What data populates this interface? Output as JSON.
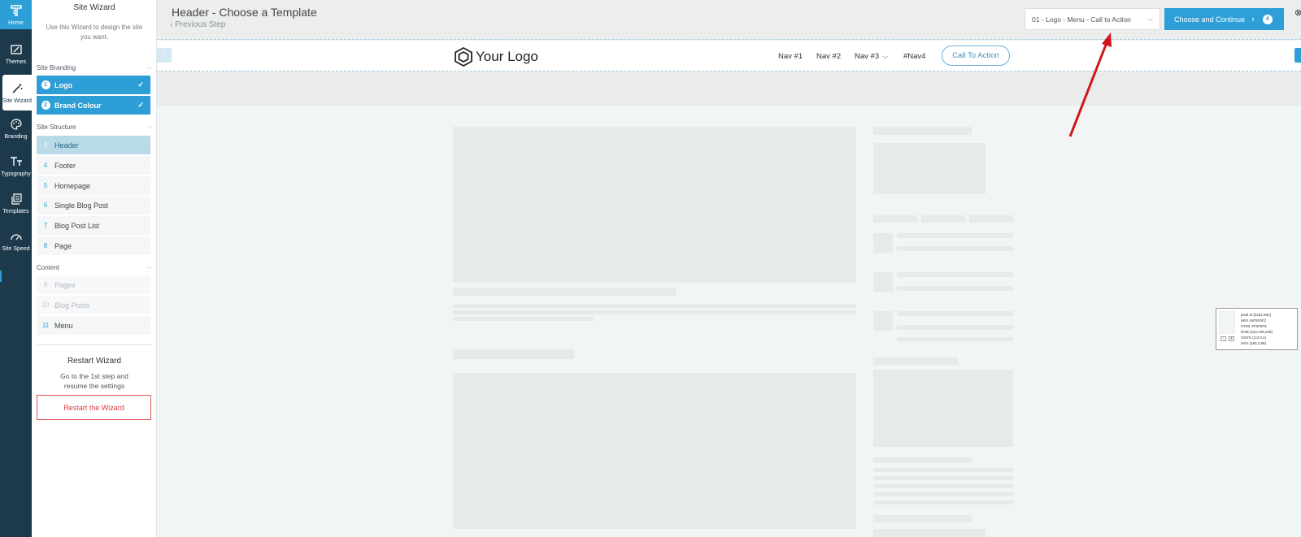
{
  "rail": {
    "items": [
      {
        "label": "Home",
        "icon": "home-icon"
      },
      {
        "label": "Themes",
        "icon": "themes-icon"
      },
      {
        "label": "Site Wizard",
        "icon": "wand-icon"
      },
      {
        "label": "Branding",
        "icon": "palette-icon"
      },
      {
        "label": "Typography",
        "icon": "typography-icon"
      },
      {
        "label": "Templates",
        "icon": "templates-icon"
      },
      {
        "label": "Site Speed",
        "icon": "speedometer-icon"
      }
    ]
  },
  "wizard": {
    "title": "Site Wizard",
    "description": "Use this Wizard to design the site you want.",
    "sections": [
      {
        "label": "Site Branding"
      },
      {
        "label": "Site Structure"
      },
      {
        "label": "Content"
      }
    ],
    "steps": [
      {
        "num": "1",
        "label": "Logo"
      },
      {
        "num": "2",
        "label": "Brand Colour"
      },
      {
        "num": "3",
        "label": "Header"
      },
      {
        "num": "4",
        "label": "Footer"
      },
      {
        "num": "5",
        "label": "Homepage"
      },
      {
        "num": "6",
        "label": "Single Blog Post"
      },
      {
        "num": "7",
        "label": "Blog Post List"
      },
      {
        "num": "8",
        "label": "Page"
      },
      {
        "num": "9",
        "label": "Pages"
      },
      {
        "num": "10",
        "label": "Blog Posts"
      },
      {
        "num": "11",
        "label": "Menu"
      }
    ],
    "check": "✓",
    "restart": {
      "title": "Restart Wizard",
      "description": "Go to the 1st step and resume the settings",
      "button": "Restart the Wizard"
    }
  },
  "topbar": {
    "title": "Header - Choose a Template",
    "previous": "Previous Step",
    "template_select": "01 - Logo - Menu - Call to Action",
    "choose_button": "Choose and Continue",
    "choose_badge": "4"
  },
  "preview": {
    "logo_text": "Your Logo",
    "nav": [
      "Nav #1",
      "Nav #2",
      "Nav #3",
      "#Nav4"
    ],
    "cta": "Call To Action"
  },
  "pixel_info": {
    "lines": [
      "pixel at [2221:681]",
      "HEX 0xF5F5F2",
      "HTML #F2F5F5",
      "RGB (242,245,245)",
      "CMYK (2,0,0,4)",
      "HSV (180,2,96)"
    ]
  },
  "colors": {
    "accent": "#2e9fd6",
    "rail": "#1d3a4c",
    "restart": "#e03a3a",
    "annotation_arrow": "#d0161a"
  }
}
